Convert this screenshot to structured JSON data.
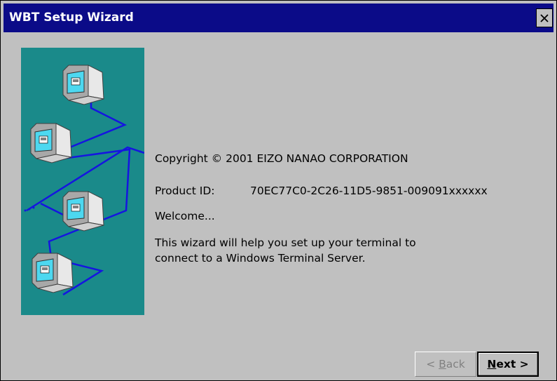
{
  "window": {
    "title": "WBT Setup Wizard",
    "close_icon": "close-icon"
  },
  "content": {
    "copyright": "Copyright © 2001 EIZO NANAO CORPORATION",
    "product_id_label": "Product ID:",
    "product_id_value": "70EC77C0-2C26-11D5-9851-009091xxxxxx",
    "welcome": "Welcome...",
    "description_line1": "This wizard will help you set up your terminal to",
    "description_line2": "connect to a Windows Terminal Server."
  },
  "buttons": {
    "back": {
      "prefix": "< ",
      "mnemonic": "B",
      "rest": "ack",
      "enabled": false
    },
    "next": {
      "mnemonic": "N",
      "rest": "ext >",
      "enabled": true
    }
  },
  "illustration": {
    "icon": "networked-computers-illustration",
    "panel_color": "#1a8a8a",
    "cable_color": "#1515e0",
    "screen_color": "#4dd8f0"
  }
}
